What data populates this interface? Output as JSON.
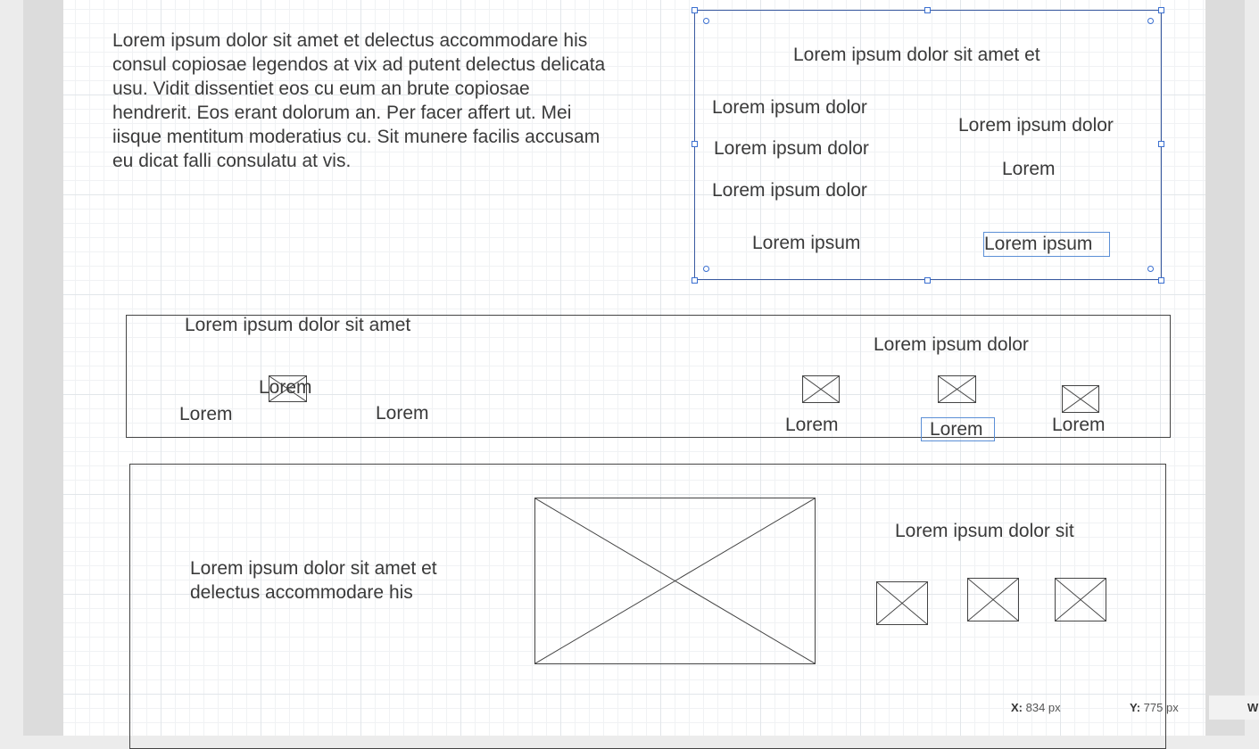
{
  "paragraph_top": "Lorem ipsum dolor sit amet et delectus accommodare his consul copiosae legendos at vix ad putent delectus delicata usu. Vidit dissentiet eos cu eum an brute copiosae hendrerit. Eos erant dolorum an. Per facer affert ut. Mei iisque mentitum moderatius cu. Sit munere facilis accusam eu dicat falli consulatu at vis.",
  "selected_card": {
    "title": "Lorem ipsum dolor sit amet et",
    "left_items": [
      "Lorem ipsum dolor",
      "Lorem ipsum dolor",
      "Lorem ipsum dolor"
    ],
    "right_item_1": "Lorem ipsum dolor",
    "right_item_2": "Lorem",
    "bottom_left": "Lorem ipsum",
    "bottom_right": "Lorem ipsum"
  },
  "nav_bar": {
    "title": "Lorem ipsum dolor sit amet",
    "left_link_1": "Lorem",
    "icon_label": "Lorem",
    "left_link_2": "Lorem",
    "right_title": "Lorem ipsum dolor",
    "right_items": [
      "Lorem",
      "Lorem",
      "Lorem"
    ]
  },
  "content_panel": {
    "text": "Lorem ipsum dolor sit amet et delectus accommodare his",
    "right_title": "Lorem ipsum dolor sit"
  },
  "status": {
    "x_label": "X:",
    "x_value": "834 px",
    "y_label": "Y:",
    "y_value": "775 px",
    "w_label": "W"
  },
  "colors": {
    "selection": "#3a6fd0",
    "text": "#3a3a3a",
    "border": "#444444"
  }
}
